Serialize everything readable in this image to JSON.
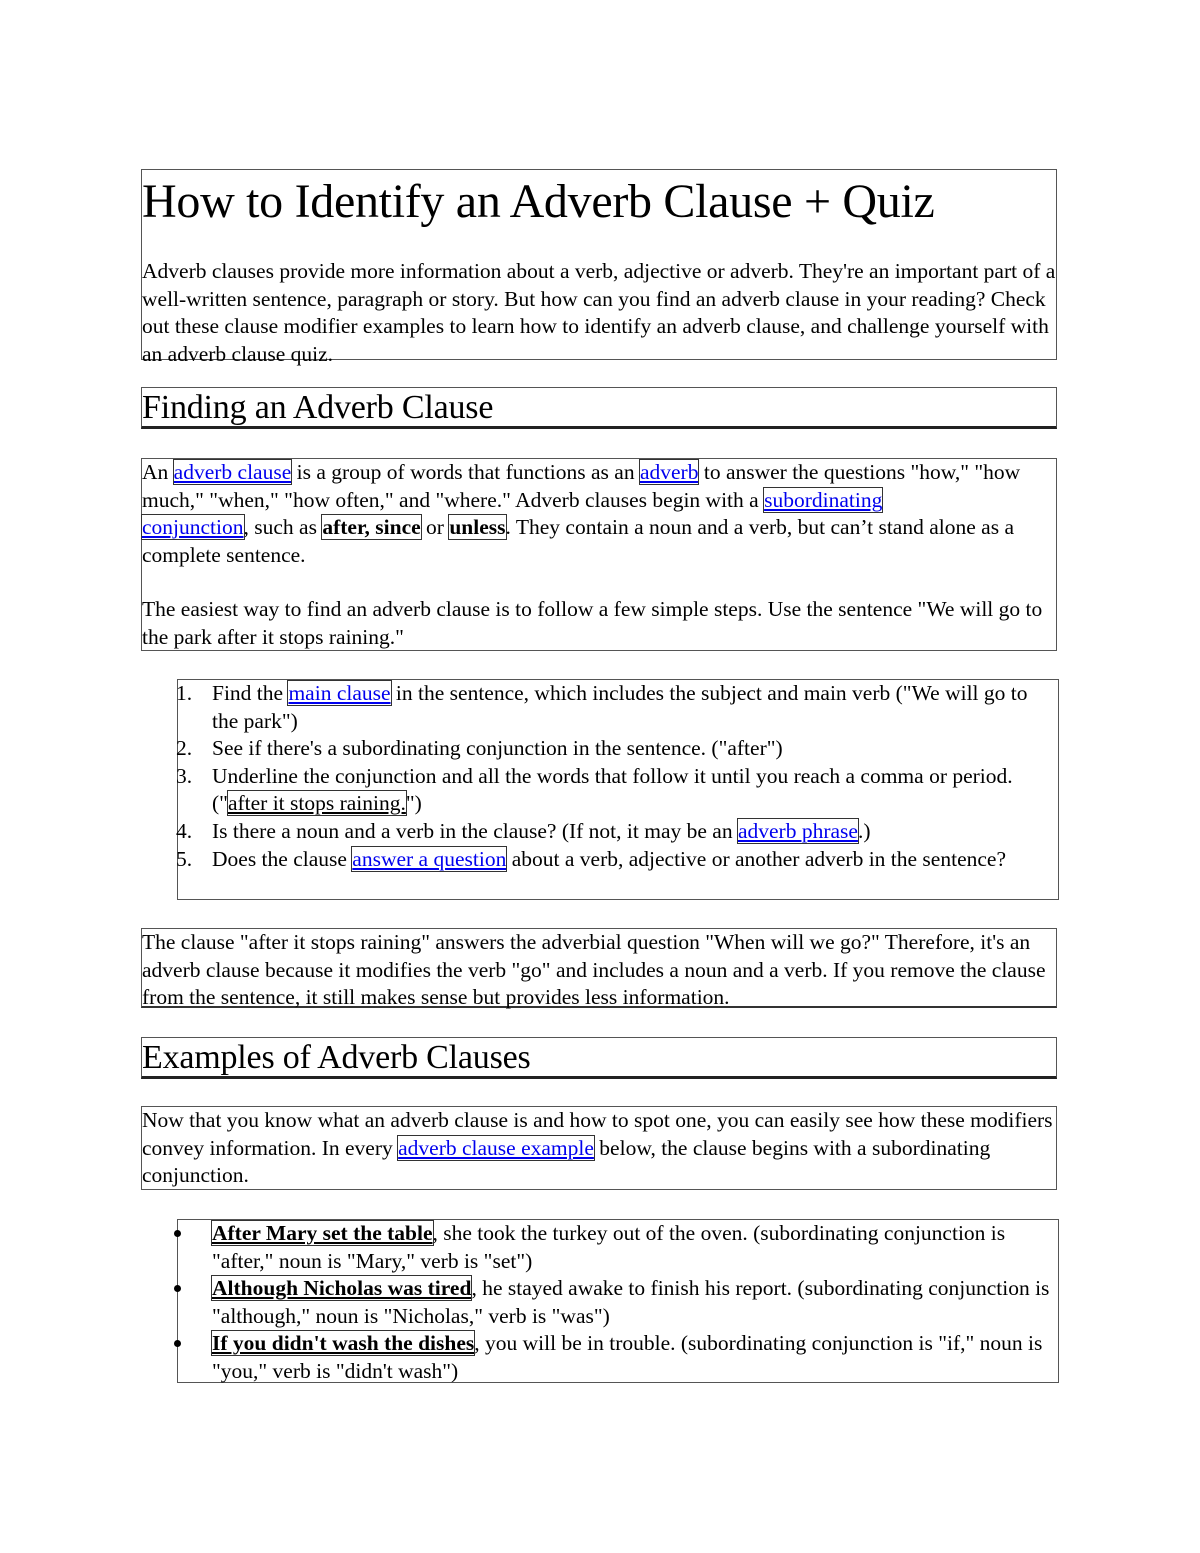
{
  "document": {
    "title": "How to Identify an Adverb Clause + Quiz",
    "intro": "Adverb clauses provide more information about a verb, adjective or adverb. They're an important part of a well-written sentence, paragraph or story. But how can you find an adverb clause in your reading? Check out these clause modifier examples to learn how to identify an adverb clause, and challenge yourself with an adverb clause quiz."
  },
  "finding": {
    "heading": "Finding an Adverb Clause",
    "p1": {
      "t1": "An ",
      "link_adverb_clause": "adverb clause",
      "t2": " is a group of words that functions as an ",
      "link_adverb": "adverb",
      "t3": " to answer the questions \"how,\" \"how much,\" \"when,\" \"how often,\" and \"where.\" Adverb clauses begin with a ",
      "link_subordinating": "subordinating ",
      "link_conjunction": "conjunction",
      "t4": ", such as ",
      "bold_after_since": "after, since",
      "t5": " or ",
      "bold_unless": "unless",
      "t6": ". They contain a noun and a verb, but can’t stand alone as a complete sentence."
    },
    "p2": "The easiest way to find an adverb clause is to follow a few simple steps. Use the sentence \"We will go to the park after it stops raining.\""
  },
  "steps": [
    {
      "num": "1.",
      "pre": "Find the ",
      "link": "main clause",
      "post": " in the sentence, which includes the subject and main verb (\"We will go to the park\")"
    },
    {
      "num": "2.",
      "text": "See if there's a subordinating conjunction in the sentence. (\"after\")"
    },
    {
      "num": "3.",
      "pre": "Underline the conjunction and all the words that follow it until you reach a comma or period. (\"",
      "underlined": "after it stops raining.",
      "post": "\")"
    },
    {
      "num": "4.",
      "pre": "Is there a noun and a verb in the clause? (If not, it may be an ",
      "link": "adverb phrase",
      "post": ".)"
    },
    {
      "num": "5.",
      "pre": "Does the clause ",
      "link": "answer a question",
      "post": " about a verb, adjective or another adverb in the sentence?"
    }
  ],
  "clause_explanation": "The clause \"after it stops raining\" answers the adverbial question \"When will we go?\" Therefore, it's an adverb clause because it modifies the verb \"go\" and includes a noun and a verb. If you remove the clause from the sentence, it still makes sense but provides less information.",
  "examples": {
    "heading": "Examples of Adverb Clauses",
    "intro_pre": "Now that you know what an adverb clause is and how to spot one, you can easily see how these modifiers convey information. In every ",
    "intro_link": "adverb clause example",
    "intro_post": " below, the clause begins with a subordinating conjunction.",
    "items": [
      {
        "clause": "After Mary set the table",
        "rest": ", she took the turkey out of the oven. (subordinating conjunction is \"after,\" noun is \"Mary,\" verb is \"set\")"
      },
      {
        "clause": "Although Nicholas was tired",
        "rest": ", he stayed awake to finish his report. (subordinating conjunction is \"although,\" noun is \"Nicholas,\" verb is \"was\")"
      },
      {
        "clause": "If you didn't wash the dishes",
        "rest": ", you will be in trouble. (subordinating conjunction is \"if,\" noun is \"you,\" verb is \"didn't wash\")"
      }
    ]
  },
  "colors": {
    "link": "#0000ee",
    "text": "#000000",
    "border": "#555555"
  }
}
